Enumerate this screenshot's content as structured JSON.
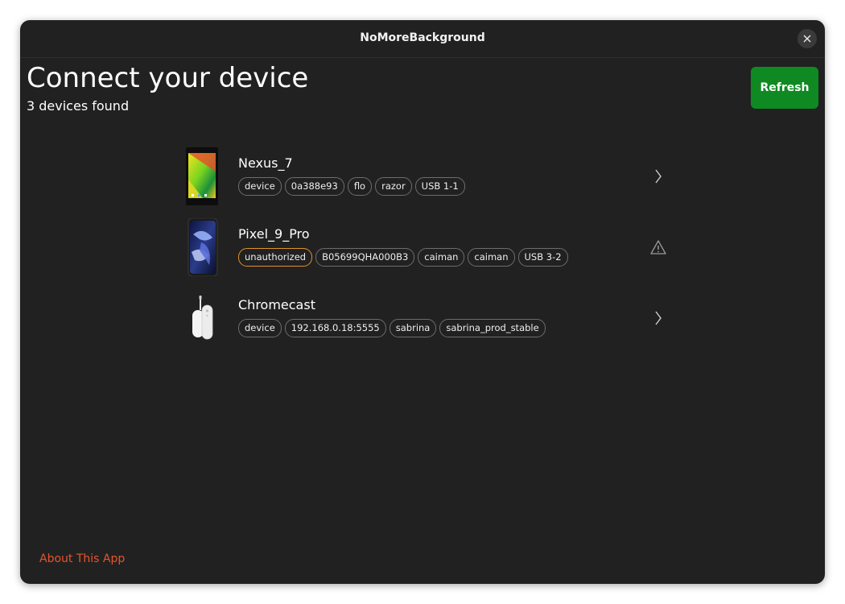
{
  "window": {
    "title": "NoMoreBackground"
  },
  "header": {
    "title": "Connect your device",
    "subtitle": "3 devices found",
    "refresh_label": "Refresh"
  },
  "devices": [
    {
      "name": "Nexus_7",
      "tags": [
        "device",
        "0a388e93",
        "flo",
        "razor",
        "USB 1-1"
      ],
      "status": "device",
      "action_icon": "chevron-right-icon"
    },
    {
      "name": "Pixel_9_Pro",
      "tags": [
        "unauthorized",
        "B05699QHA000B3",
        "caiman",
        "caiman",
        "USB 3-2"
      ],
      "status": "unauthorized",
      "action_icon": "warning-icon"
    },
    {
      "name": "Chromecast",
      "tags": [
        "device",
        "192.168.0.18:5555",
        "sabrina",
        "sabrina_prod_stable"
      ],
      "status": "device",
      "action_icon": "chevron-right-icon"
    }
  ],
  "footer": {
    "about_label": "About This App"
  },
  "colors": {
    "window_bg": "#212121",
    "accent_button": "#0f8a23",
    "link": "#e5552c",
    "warning_tag_border": "#e0922a",
    "tag_border": "#6d6d6d"
  }
}
